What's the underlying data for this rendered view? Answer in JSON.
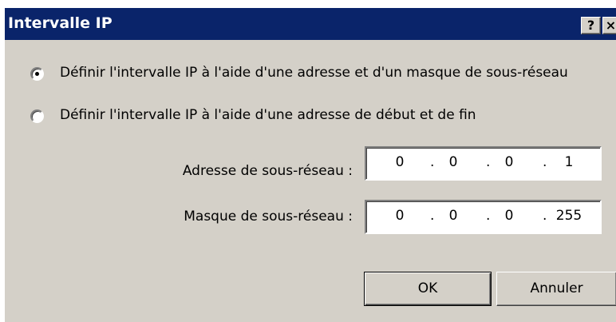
{
  "dialog": {
    "title": "Intervalle IP",
    "help_label": "?",
    "close_label": "×"
  },
  "options": {
    "mask_label": "Définir l'intervalle IP à l'aide d'une adresse et d'un masque de sous-réseau",
    "range_label": "Définir l'intervalle IP à l'aide d'une adresse de début et de fin",
    "selected": "mask"
  },
  "subnet_address": {
    "label": "Adresse de sous-réseau :",
    "octets": [
      "0",
      "0",
      "0",
      "1"
    ]
  },
  "subnet_mask": {
    "label": "Masque de sous-réseau :",
    "octets": [
      "0",
      "0",
      "0",
      "255"
    ]
  },
  "separator": ".",
  "buttons": {
    "ok_label": "OK",
    "cancel_label": "Annuler"
  },
  "colors": {
    "titlebar": "#0a246a",
    "dialog_bg": "#d4d0c8"
  }
}
